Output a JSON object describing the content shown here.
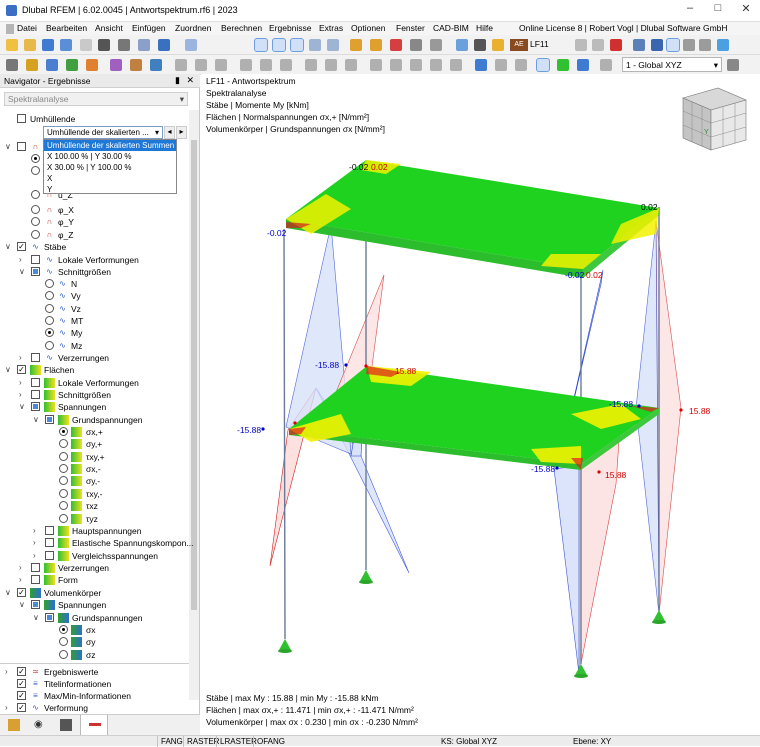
{
  "window": {
    "title": "Dlubal RFEM | 6.02.0045 | Antwortspektrum.rf6 | 2023"
  },
  "menu": {
    "items": [
      "Datei",
      "Bearbeiten",
      "Ansicht",
      "Einfügen",
      "Zuordnen",
      "Berechnen",
      "Ergebnisse",
      "Extras",
      "Optionen",
      "Fenster",
      "CAD-BIM",
      "Hilfe"
    ],
    "license": "Online License 8 | Robert Vogl | Dlubal Software GmbH"
  },
  "toolbar": {
    "load_case_badge": "AE",
    "load_case": "LF11",
    "coord_system": "1 - Global XYZ"
  },
  "navigator": {
    "title": "Navigator - Ergebnisse",
    "analysis": "Spektralanalyse",
    "envelope": "Umhüllende",
    "combo_value": "Umhüllende der skalierten ...",
    "options": [
      "Umhüllende der skalierten Summen",
      "X 100.00 % | Y 30.00 %",
      "X 30.00 % | Y 100.00 %",
      "X",
      "Y"
    ],
    "tree": {
      "stab_items": [
        "u_Z",
        "φ_X",
        "φ_Y",
        "φ_Z"
      ],
      "staebe": "Stäbe",
      "lokale_verformungen": "Lokale Verformungen",
      "schnittgroessen": "Schnittgrößen",
      "forces": [
        "N",
        "Vy",
        "Vz",
        "MT",
        "My",
        "Mz"
      ],
      "verzerrungen": "Verzerrungen",
      "flaechen": "Flächen",
      "lokale_verformungen2": "Lokale Verformungen",
      "schnittgroessen2": "Schnittgrößen",
      "spannungen": "Spannungen",
      "grundspannungen": "Grundspannungen",
      "stresses": [
        "σx,+",
        "σy,+",
        "τxy,+",
        "σx,-",
        "σy,-",
        "τxy,-",
        "τxz",
        "τyz"
      ],
      "hauptspannungen": "Hauptspannungen",
      "elastische": "Elastische Spannungskompon...",
      "vergleich": "Vergleichsspannungen",
      "verzerrungen2": "Verzerrungen",
      "form": "Form",
      "volumen": "Volumenkörper",
      "spannungen2": "Spannungen",
      "grundspannungen2": "Grundspannungen",
      "vstresses": [
        "σx",
        "σy",
        "σz"
      ],
      "bottom": [
        "Ergebniswerte",
        "Titelinformationen",
        "Max/Min-Informationen",
        "Verformung"
      ]
    }
  },
  "view": {
    "header": [
      "LF11 - Antwortspektrum",
      "Spektralanalyse",
      "Stäbe | Momente My [kNm]",
      "Flächen | Normalspannungen σx,+ [N/mm²]",
      "Volumenkörper | Grundspannungen σx [N/mm²]"
    ],
    "labels": {
      "top_l": "-0.02",
      "top_r": "0.02",
      "top_mid_l": "-0.02",
      "top_mid_r": "-0.02",
      "top_right": "0.02",
      "top_left": "-0.02",
      "top_front": "0.02",
      "m_neg": "-15.88",
      "m_pos": "15.88"
    },
    "footer": [
      "Stäbe | max My : 15.88 | min My : -15.88 kNm",
      "Flächen | max σx,+ : 11.471 | min σx,+ : -11.471 N/mm²",
      "Volumenkörper | max σx : 0.230 | min σx : -0.230 N/mm²"
    ]
  },
  "statusbar": {
    "items": [
      "FANG",
      "RASTER",
      "LRASTER",
      "OFANG"
    ],
    "ks": "KS: Global XYZ",
    "ebene": "Ebene: XY"
  },
  "colors": {
    "accent": "#1e78d8",
    "plate_green": "#1fd21f",
    "plate_yellow": "#f2f200",
    "pos": "#e60000",
    "neg": "#0000cc"
  }
}
